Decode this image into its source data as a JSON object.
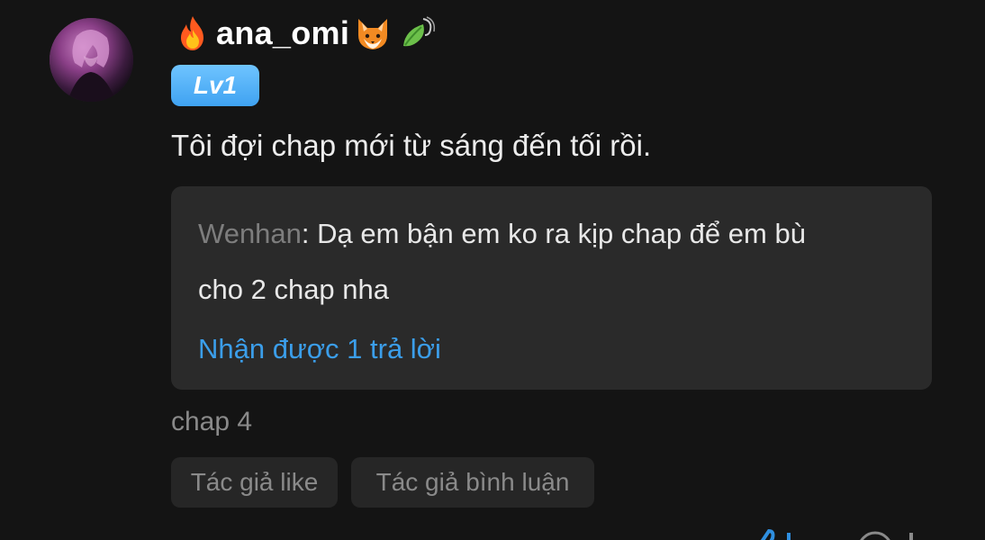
{
  "user": {
    "name": "ana_omi",
    "level": "Lv1",
    "name_prefix_icon": "fire-icon",
    "name_suffix_icons": [
      "fox-icon",
      "leaf-swirl-icon"
    ]
  },
  "comment": {
    "text": "Tôi đợi chap mới từ sáng đến tối rồi."
  },
  "reply": {
    "author": "Wenhan",
    "separator": ": ",
    "line1": "Dạ em bận em ko ra kịp chap để em bù",
    "line2": "cho 2 chap nha",
    "count_text": "Nhận được 1 trả lời"
  },
  "chapter": "chap 4",
  "tags": [
    "Tác giả like",
    "Tác giả bình luận"
  ],
  "colors": {
    "background": "#141414",
    "level_badge": "#4aa9f4",
    "reply_box": "#2a2a2a",
    "link_blue": "#3b9eea"
  }
}
